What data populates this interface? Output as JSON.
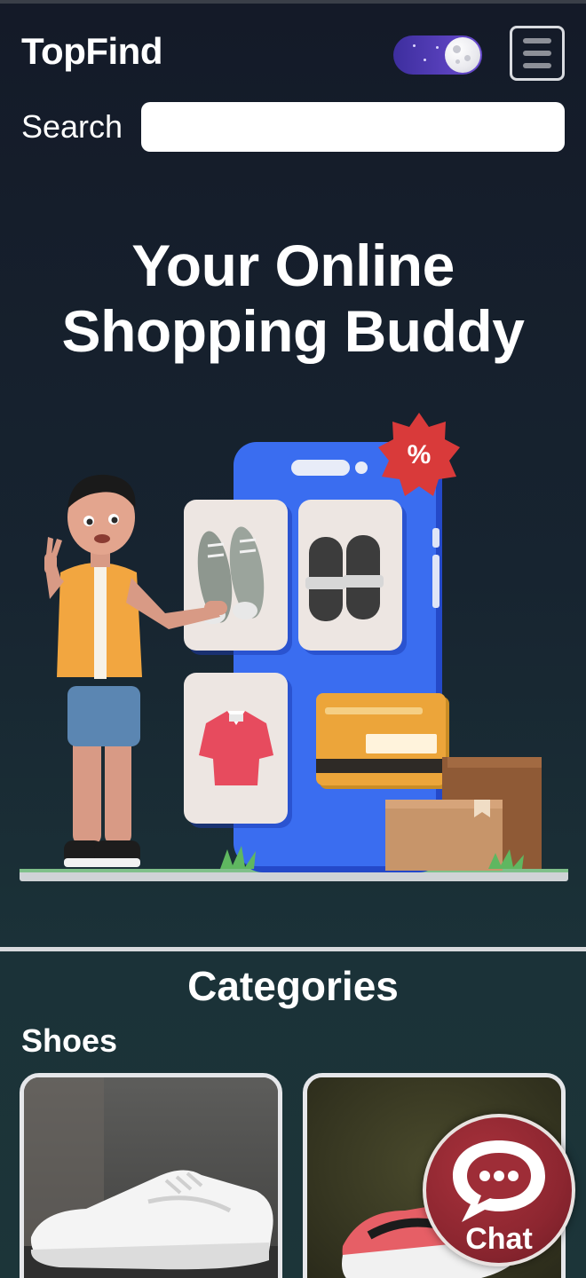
{
  "header": {
    "logo": "TopFind",
    "search_label": "Search",
    "search_value": "",
    "search_placeholder": ""
  },
  "hero": {
    "title_line1": "Your Online",
    "title_line2": "Shopping Buddy",
    "badge_symbol": "%"
  },
  "categories": {
    "title": "Categories",
    "groups": [
      {
        "name": "Shoes"
      }
    ]
  },
  "chat": {
    "label": "Chat"
  },
  "icons": [
    "moon-icon",
    "hamburger-menu-icon",
    "chat-bubble-icon"
  ],
  "colors": {
    "background_top": "#141a28",
    "background_bottom": "#1c3539",
    "toggle": "#5a3fc0",
    "chat": "#8d2630",
    "phone_blue": "#2f63ea"
  }
}
